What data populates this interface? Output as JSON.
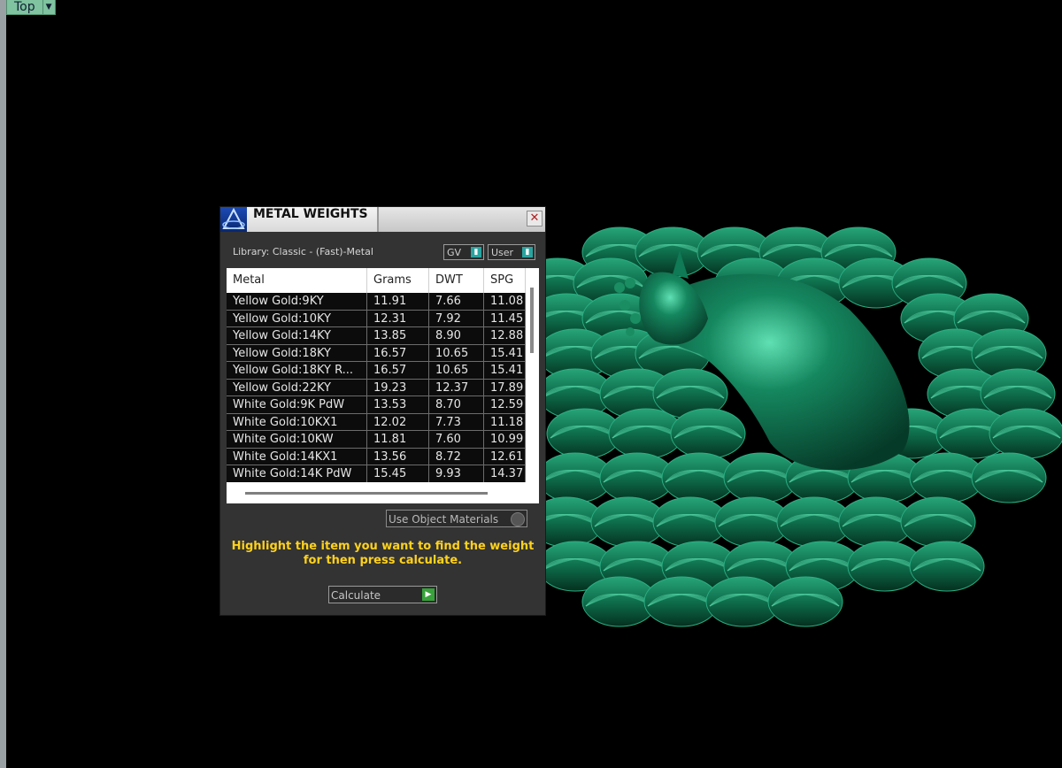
{
  "viewport": {
    "view_label": "Top",
    "dropdown_icon": "triangle-down-icon"
  },
  "dialog": {
    "title": "METAL WEIGHTS",
    "close_icon": "x-close-icon",
    "library_text": "Library: Classic - (Fast)-Metal",
    "toggles": {
      "gv": "GV",
      "user": "User"
    },
    "table": {
      "headers": [
        "Metal",
        "Grams",
        "DWT",
        "SPG"
      ],
      "rows": [
        [
          "Yellow Gold:9KY",
          "11.91",
          "7.66",
          "11.08"
        ],
        [
          "Yellow Gold:10KY",
          "12.31",
          "7.92",
          "11.45"
        ],
        [
          "Yellow Gold:14KY",
          "13.85",
          "8.90",
          "12.88"
        ],
        [
          "Yellow Gold:18KY",
          "16.57",
          "10.65",
          "15.41"
        ],
        [
          "Yellow Gold:18KY R...",
          "16.57",
          "10.65",
          "15.41"
        ],
        [
          "Yellow Gold:22KY",
          "19.23",
          "12.37",
          "17.89"
        ],
        [
          "White Gold:9K PdW",
          "13.53",
          "8.70",
          "12.59"
        ],
        [
          "White Gold:10KX1",
          "12.02",
          "7.73",
          "11.18"
        ],
        [
          "White Gold:10KW",
          "11.81",
          "7.60",
          "10.99"
        ],
        [
          "White Gold:14KX1",
          "13.56",
          "8.72",
          "12.61"
        ],
        [
          "White Gold:14K PdW",
          "15.45",
          "9.93",
          "14.37"
        ]
      ]
    },
    "use_object_materials": "Use Object Materials",
    "hint_line1": "Highlight the item you want to find the weight",
    "hint_line2": "for then press calculate.",
    "calculate": "Calculate",
    "accent_colors": {
      "hint": "#ffd21c",
      "toggle": "#2aa4a0",
      "go": "#38a23b",
      "model": "#0e7a55"
    }
  }
}
